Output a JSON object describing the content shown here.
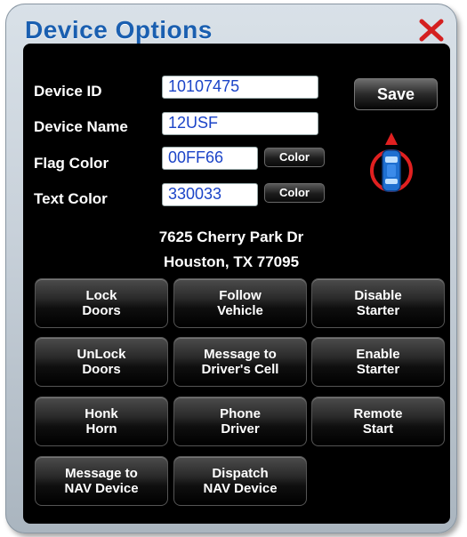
{
  "dialog": {
    "title": "Device Options"
  },
  "fields": {
    "device_id": {
      "label": "Device ID",
      "value": "10107475"
    },
    "device_name": {
      "label": "Device Name",
      "value": "12USF"
    },
    "flag_color": {
      "label": "Flag Color",
      "value": "00FF66",
      "button": "Color"
    },
    "text_color": {
      "label": "Text Color",
      "value": "330033",
      "button": "Color"
    }
  },
  "save_label": "Save",
  "address": {
    "line1": "7625 Cherry Park Dr",
    "line2": "Houston, TX 77095"
  },
  "actions": [
    {
      "line1": "Lock",
      "line2": "Doors"
    },
    {
      "line1": "Follow",
      "line2": "Vehicle"
    },
    {
      "line1": "Disable",
      "line2": "Starter"
    },
    {
      "line1": "UnLock",
      "line2": "Doors"
    },
    {
      "line1": "Message to",
      "line2": "Driver's Cell"
    },
    {
      "line1": "Enable",
      "line2": "Starter"
    },
    {
      "line1": "Honk",
      "line2": "Horn"
    },
    {
      "line1": "Phone",
      "line2": "Driver"
    },
    {
      "line1": "Remote",
      "line2": "Start"
    },
    {
      "line1": "Message to",
      "line2": "NAV Device"
    },
    {
      "line1": "Dispatch",
      "line2": "NAV Device"
    }
  ],
  "icons": {
    "close": "close-x-icon",
    "vehicle": "vehicle-direction-icon"
  },
  "colors": {
    "title": "#1a5fb0",
    "close": "#d42020",
    "input_text": "#1b44c8",
    "panel": "#000000",
    "vehicle_ring": "#e02020",
    "vehicle_body": "#1e6fd0"
  }
}
